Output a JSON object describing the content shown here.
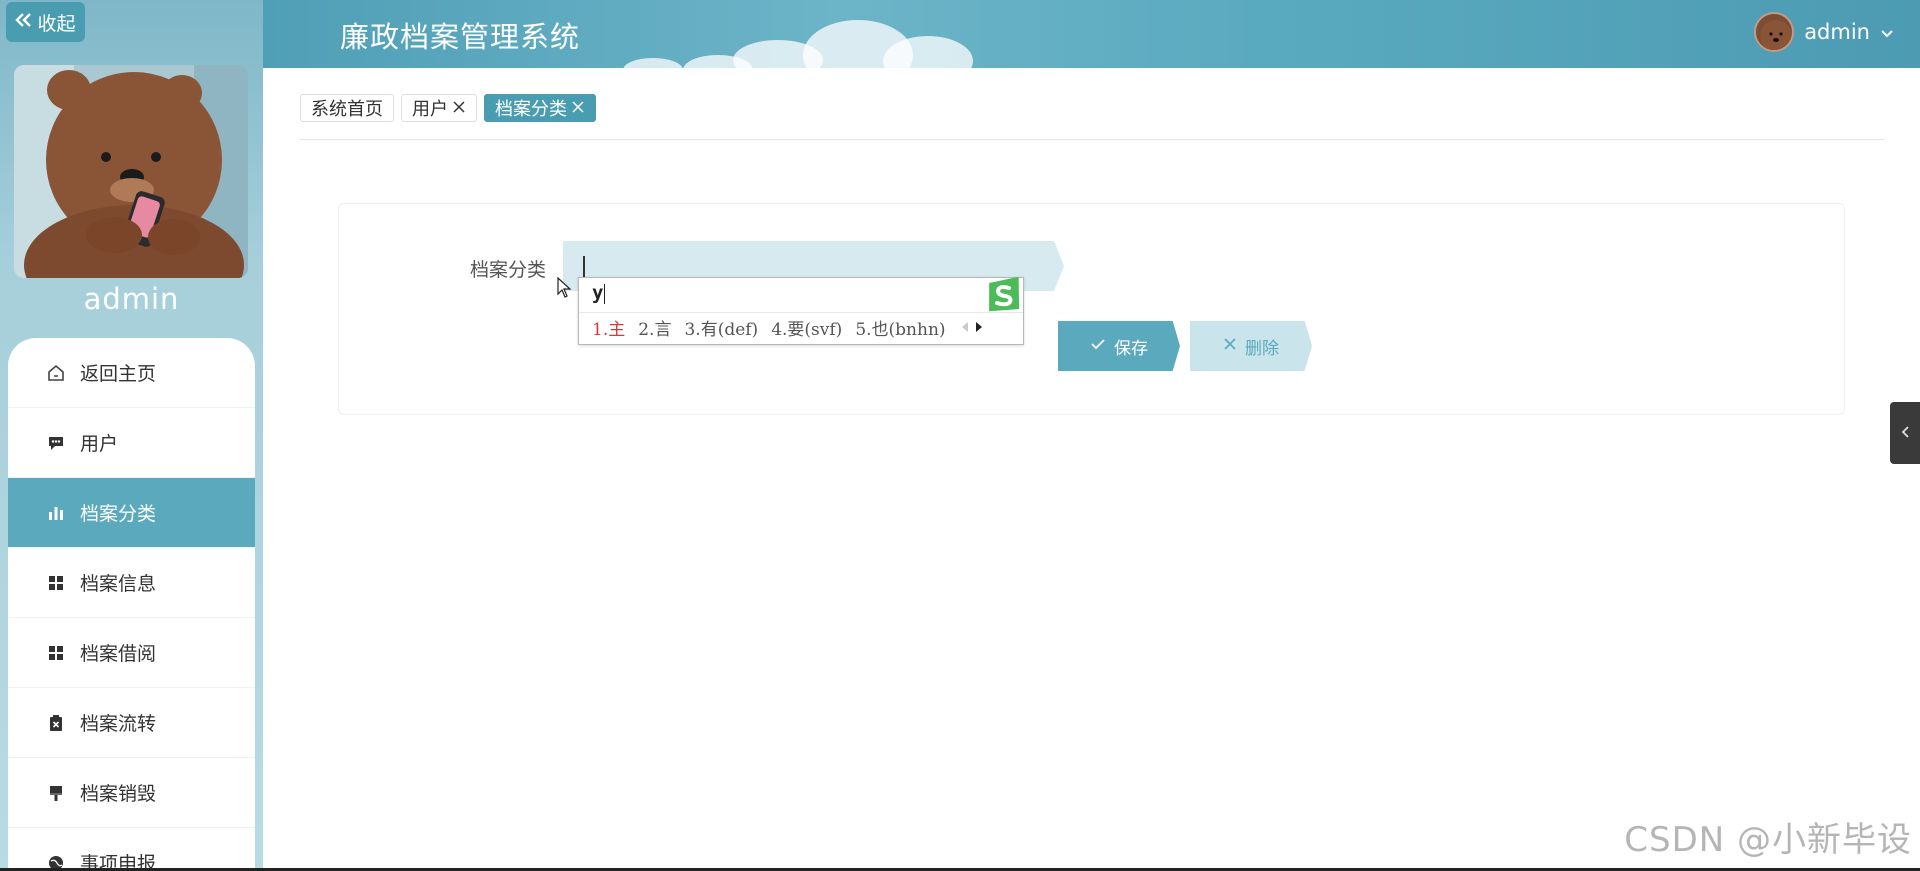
{
  "sidebar": {
    "collapse_label": "收起",
    "username": "admin",
    "items": [
      {
        "label": "返回主页",
        "icon": "home-icon"
      },
      {
        "label": "用户",
        "icon": "chat-icon"
      },
      {
        "label": "档案分类",
        "icon": "bar-chart-icon",
        "active": true
      },
      {
        "label": "档案信息",
        "icon": "grid-icon"
      },
      {
        "label": "档案借阅",
        "icon": "grid-icon"
      },
      {
        "label": "档案流转",
        "icon": "clipboard-x-icon"
      },
      {
        "label": "档案销毁",
        "icon": "brush-icon"
      },
      {
        "label": "事项申报",
        "icon": "globe-icon"
      }
    ]
  },
  "header": {
    "title": "廉政档案管理系统",
    "username": "admin"
  },
  "tabs": [
    {
      "label": "系统首页",
      "closable": false,
      "active": false
    },
    {
      "label": "用户",
      "closable": true,
      "active": false
    },
    {
      "label": "档案分类",
      "closable": true,
      "active": true
    }
  ],
  "form": {
    "field_label": "档案分类",
    "field_value": "",
    "save_label": "保存",
    "delete_label": "删除"
  },
  "ime": {
    "input": "y",
    "candidates": [
      "1.主",
      "2.言",
      "3.有(def)",
      "4.要(svf)",
      "5.也(bnhn)"
    ]
  },
  "watermark": "CSDN @小新毕设",
  "colors": {
    "accent": "#5aa9bd",
    "accent_dark": "#4a9db1",
    "input_bg": "#d6eaef"
  }
}
